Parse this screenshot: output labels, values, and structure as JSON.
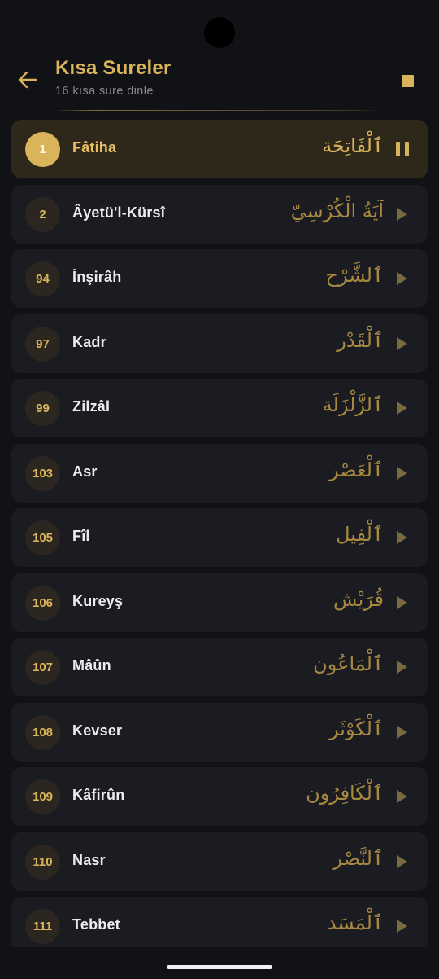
{
  "header": {
    "title": "Kısa Sureler",
    "subtitle": "16 kısa sure dinle"
  },
  "colors": {
    "accent": "#d9b45a",
    "background": "#111216",
    "row_background": "#1a1c22",
    "active_row_background": "#2d2819"
  },
  "icons": {
    "back": "arrow-left-icon",
    "stop": "stop-icon",
    "play": "play-icon",
    "pause": "pause-icon"
  },
  "surahs": [
    {
      "number": "1",
      "name": "Fâtiha",
      "arabic": "ٱلْفَاتِحَة",
      "playing": true
    },
    {
      "number": "2",
      "name": "Âyetü'l-Kürsî",
      "arabic": "آيَةُ الْكُرْسِيّ",
      "playing": false
    },
    {
      "number": "94",
      "name": "İnşirâh",
      "arabic": "ٱلشَّرْح",
      "playing": false
    },
    {
      "number": "97",
      "name": "Kadr",
      "arabic": "ٱلْقَدْر",
      "playing": false
    },
    {
      "number": "99",
      "name": "Zilzâl",
      "arabic": "ٱلزَّلْزَلَة",
      "playing": false
    },
    {
      "number": "103",
      "name": "Asr",
      "arabic": "ٱلْعَصْر",
      "playing": false
    },
    {
      "number": "105",
      "name": "Fîl",
      "arabic": "ٱلْفِيل",
      "playing": false
    },
    {
      "number": "106",
      "name": "Kureyş",
      "arabic": "قُرَيْش",
      "playing": false
    },
    {
      "number": "107",
      "name": "Mâûn",
      "arabic": "ٱلْمَاعُون",
      "playing": false
    },
    {
      "number": "108",
      "name": "Kevser",
      "arabic": "ٱلْكَوْثَر",
      "playing": false
    },
    {
      "number": "109",
      "name": "Kâfirûn",
      "arabic": "ٱلْكَافِرُون",
      "playing": false
    },
    {
      "number": "110",
      "name": "Nasr",
      "arabic": "ٱلنَّصْر",
      "playing": false
    },
    {
      "number": "111",
      "name": "Tebbet",
      "arabic": "ٱلْمَسَد",
      "playing": false
    }
  ]
}
